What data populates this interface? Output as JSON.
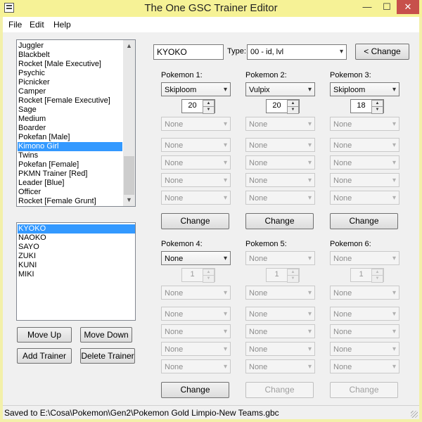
{
  "window": {
    "title": "The One GSC Trainer Editor",
    "minimize": "—",
    "maximize": "☐",
    "close": "✕",
    "icon": "app-icon"
  },
  "menu": [
    "File",
    "Edit",
    "Help"
  ],
  "trainer_classes": {
    "items": [
      "Juggler",
      "Blackbelt",
      "Rocket [Male Executive]",
      "Psychic",
      "Picnicker",
      "Camper",
      "Rocket [Female Executive]",
      "Sage",
      "Medium",
      "Boarder",
      "Pokefan [Male]",
      "Kimono Girl",
      "Twins",
      "Pokefan [Female]",
      "PKMN Trainer [Red]",
      "Leader [Blue]",
      "Officer",
      "Rocket [Female Grunt]"
    ],
    "selected": "Kimono Girl",
    "scroll_up": "▲",
    "scroll_down": "▼"
  },
  "trainers": {
    "items": [
      "KYOKO",
      "NAOKO",
      "SAYO",
      "ZUKI",
      "KUNI",
      "MIKI"
    ],
    "selected": "KYOKO"
  },
  "buttons": {
    "move_up": "Move Up",
    "move_down": "Move Down",
    "add_trainer": "Add Trainer",
    "delete_trainer": "Delete Trainer",
    "change_name": "< Change",
    "change": "Change"
  },
  "name_field": "KYOKO",
  "type": {
    "label": "Type:",
    "value": "00 - id, lvl"
  },
  "combo_arrow": "▾",
  "spin_up": "▲",
  "spin_down": "▼",
  "pokemon": [
    {
      "label": "Pokemon 1:",
      "species": "Skiploom",
      "level": "20",
      "moves": [
        "None",
        "None",
        "None",
        "None",
        "None"
      ],
      "enabled": true
    },
    {
      "label": "Pokemon 2:",
      "species": "Vulpix",
      "level": "20",
      "moves": [
        "None",
        "None",
        "None",
        "None",
        "None"
      ],
      "enabled": true
    },
    {
      "label": "Pokemon 3:",
      "species": "Skiploom",
      "level": "18",
      "moves": [
        "None",
        "None",
        "None",
        "None",
        "None"
      ],
      "enabled": true
    },
    {
      "label": "Pokemon 4:",
      "species": "None",
      "level": "1",
      "moves": [
        "None",
        "None",
        "None",
        "None",
        "None"
      ],
      "enabled": true
    },
    {
      "label": "Pokemon 5:",
      "species": "None",
      "level": "1",
      "moves": [
        "None",
        "None",
        "None",
        "None",
        "None"
      ],
      "enabled": false
    },
    {
      "label": "Pokemon 6:",
      "species": "None",
      "level": "1",
      "moves": [
        "None",
        "None",
        "None",
        "None",
        "None"
      ],
      "enabled": false
    }
  ],
  "status": "Saved to E:\\Cosa\\Pokemon\\Gen2\\Pokemon Gold Limpio-New Teams.gbc"
}
